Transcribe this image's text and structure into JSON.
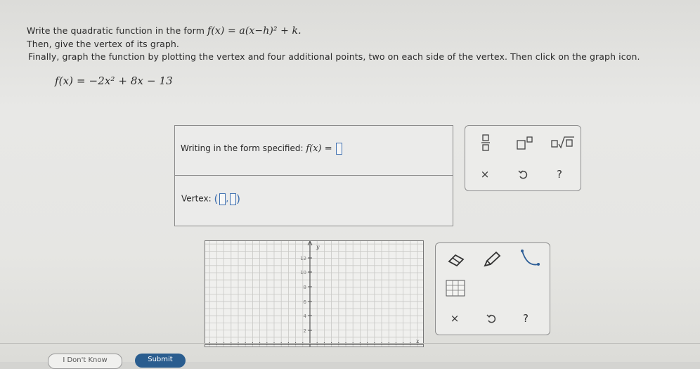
{
  "instructions": {
    "line1_prefix": "Write the quadratic function in the form",
    "line1_formula": "f(x) = a(x−h)² + k.",
    "line2": "Then, give the vertex of its graph.",
    "line3": "Finally, graph the function by plotting the vertex and four additional points, two on each side of the vertex. Then click on the graph icon."
  },
  "function_given": "f(x) = −2x² + 8x − 13",
  "answer_box": {
    "form_label": "Writing in the form specified:",
    "form_expr": "f(x) =",
    "vertex_label": "Vertex:"
  },
  "math_toolbar": {
    "icons": [
      "fraction-icon",
      "superscript-icon",
      "sqrt-icon",
      "clear-icon",
      "undo-icon",
      "help-icon"
    ],
    "clear_label": "×",
    "help_label": "?"
  },
  "graph_toolbar": {
    "icons": [
      "eraser-icon",
      "pencil-icon",
      "parabola-icon",
      "graph-table-icon",
      "clear-icon",
      "undo-icon",
      "help-icon"
    ],
    "clear_label": "×",
    "help_label": "?"
  },
  "graph": {
    "y_axis_label": "y",
    "x_axis_label": "x",
    "y_ticks": [
      "12",
      "10",
      "8",
      "6",
      "4",
      "2"
    ]
  },
  "footer": {
    "dont_know_label": "I Don't Know",
    "submit_label": "Submit"
  },
  "colors": {
    "accent": "#3d6fb0",
    "submit_bg": "#2a5d8f"
  }
}
